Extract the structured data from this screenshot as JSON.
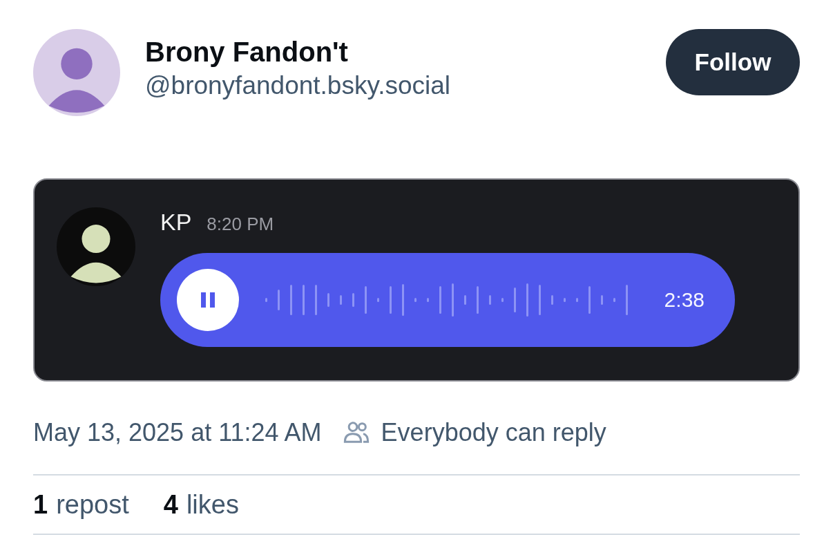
{
  "author": {
    "name": "Brony Fandon't",
    "handle": "@bronyfandont.bsky.social",
    "following": false,
    "follow_label": "Follow"
  },
  "embed": {
    "kind": "voice-message",
    "sender": "KP",
    "time": "8:20 PM",
    "playing": true,
    "duration": "2:38"
  },
  "meta": {
    "timestamp": "May 13, 2025 at 11:24 AM",
    "reply_setting": "Everybody can reply"
  },
  "stats": [
    {
      "count": "1",
      "label": "repost"
    },
    {
      "count": "4",
      "label": "likes"
    }
  ]
}
